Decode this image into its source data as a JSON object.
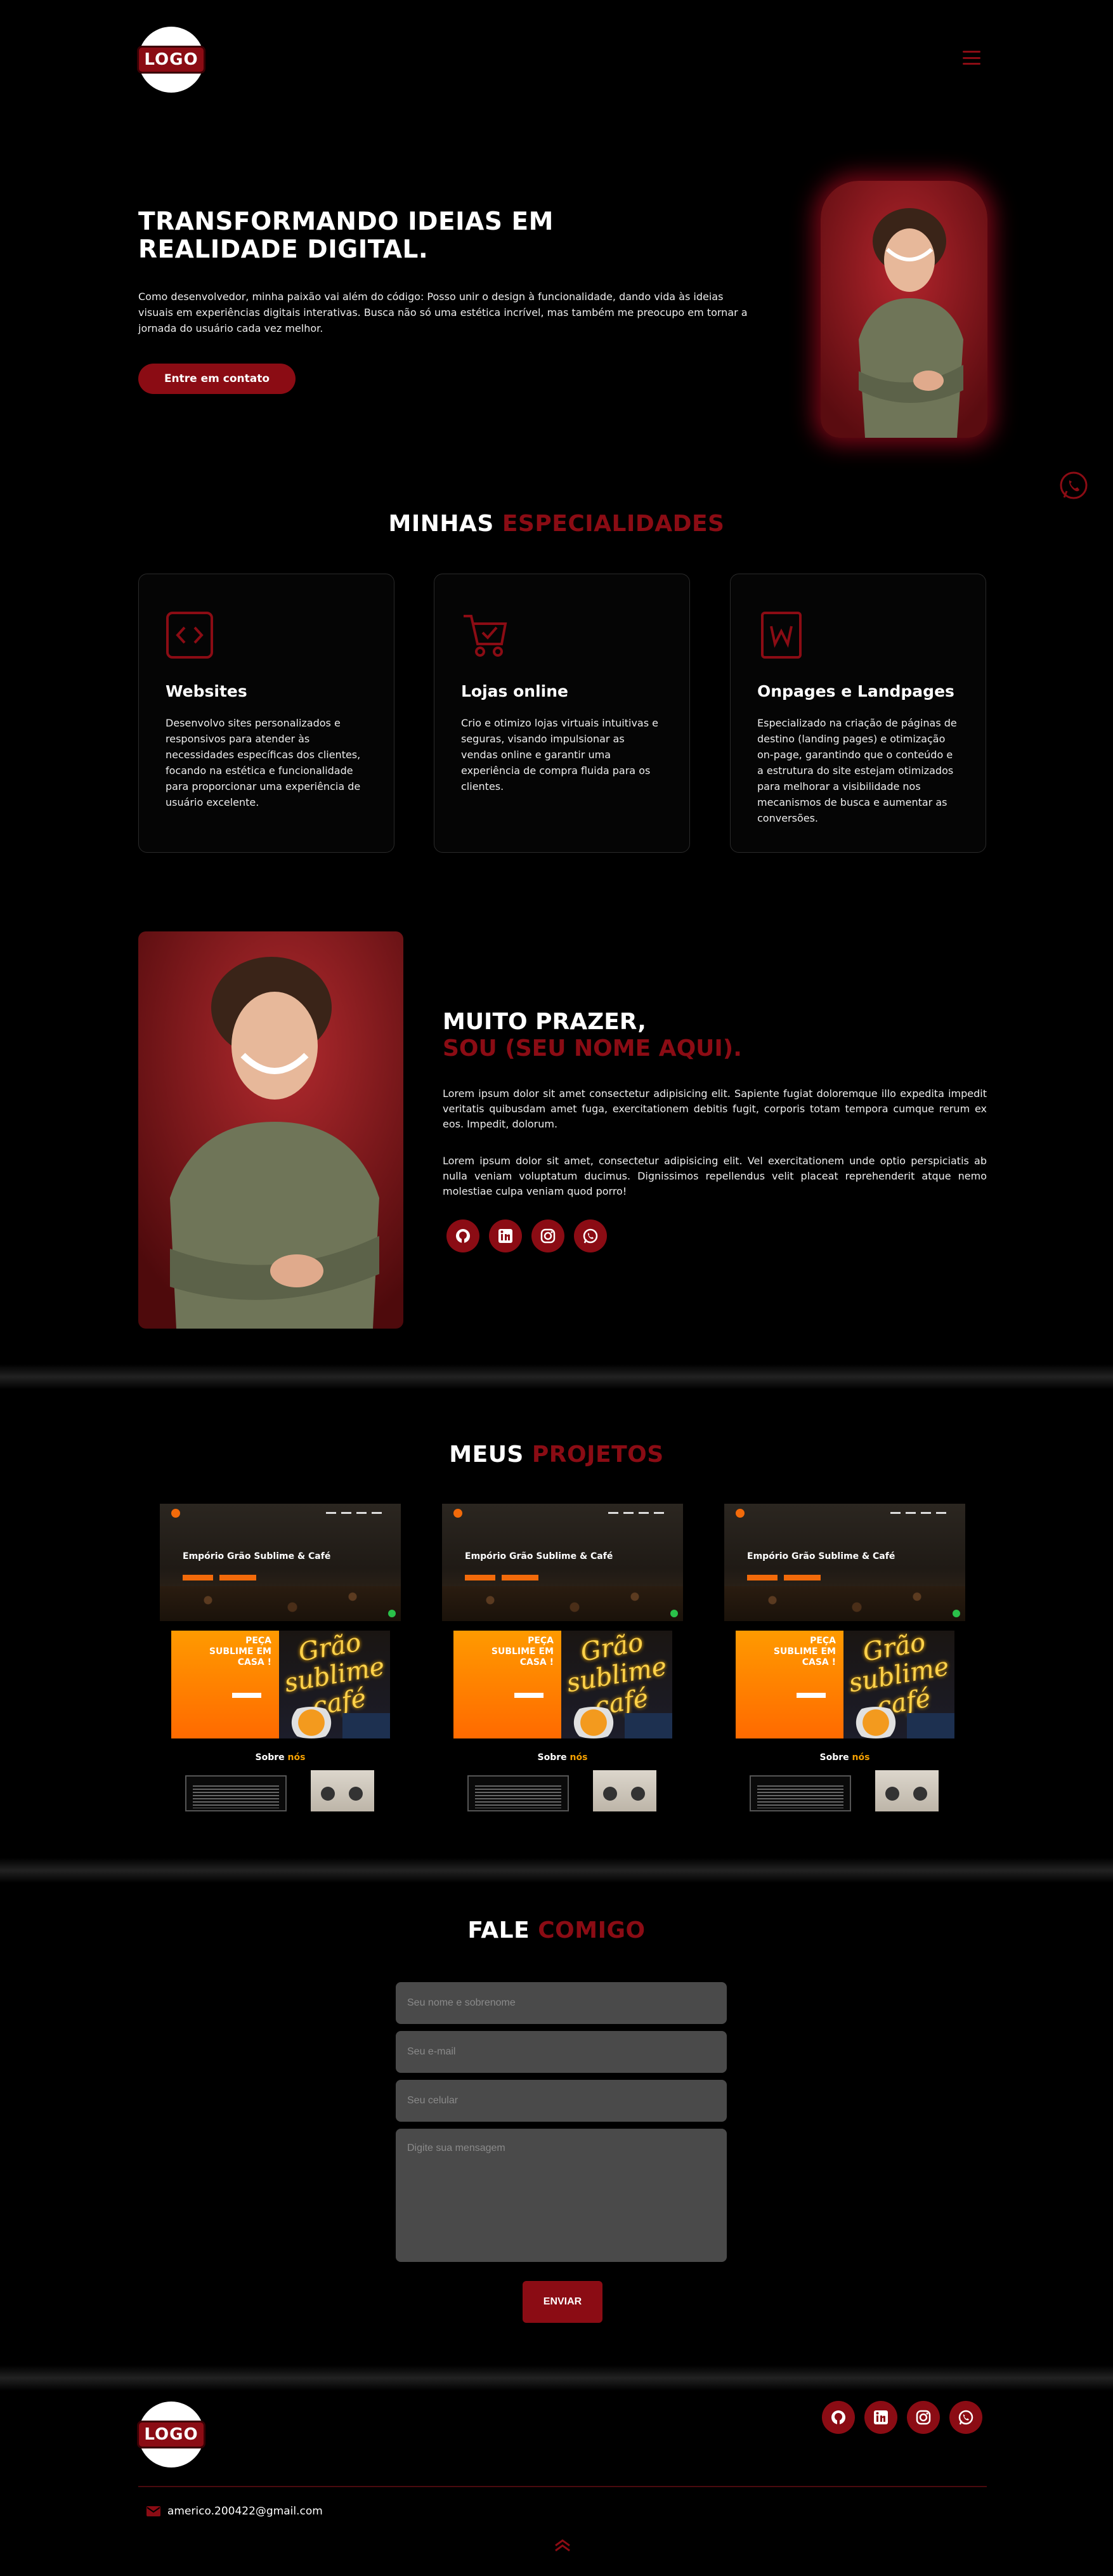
{
  "header": {
    "logo_text": "LOGO"
  },
  "hero": {
    "title": "TRANSFORMANDO IDEIAS EM REALIDADE DIGITAL.",
    "text": "Como desenvolvedor, minha paixão vai além do código: Posso unir o design à funcionalidade, dando vida às ideias visuais em experiências digitais interativas. Busca não só uma estética incrível, mas também me preocupo em tornar a jornada do usuário cada vez melhor.",
    "button": "Entre em contato"
  },
  "specialties": {
    "title_white": "MINHAS",
    "title_red": "ESPECIALIDADES",
    "cards": [
      {
        "icon": "code-icon",
        "title": "Websites",
        "text": "Desenvolvo sites personalizados e responsivos para atender às necessidades específicas dos clientes, focando na estética e funcionalidade para proporcionar uma experiência de usuário excelente."
      },
      {
        "icon": "shopping-cart-icon",
        "title": "Lojas online",
        "text": "Crio e otimizo lojas virtuais intuitivas e seguras, visando impulsionar as vendas online e garantir uma experiência de compra fluida para os clientes."
      },
      {
        "icon": "wordpress-icon",
        "title": "Onpages e Landpages",
        "text": "Especializado na criação de páginas de destino (landing pages) e otimização on-page, garantindo que o conteúdo e a estrutura do site estejam otimizados para melhorar a visibilidade nos mecanismos de busca e aumentar as conversões."
      }
    ]
  },
  "about": {
    "title_white": "MUITO PRAZER,",
    "title_red": "SOU (SEU NOME AQUI).",
    "paragraph1": "Lorem ipsum dolor sit amet consectetur adipisicing elit. Sapiente fugiat doloremque illo expedita impedit veritatis quibusdam amet fuga, exercitationem debitis fugit, corporis totam tempora cumque rerum ex eos. Impedit, dolorum.",
    "paragraph2": "Lorem ipsum dolor sit amet, consectetur adipisicing elit. Vel exercitationem unde optio perspiciatis ab nulla veniam voluptatum ducimus. Dignissimos repellendus velit placeat reprehenderit atque nemo molestiae culpa veniam quod porro!",
    "social_icons": [
      "github-icon",
      "linkedin-icon",
      "instagram-icon",
      "whatsapp-icon"
    ]
  },
  "projects": {
    "title_white": "MEUS",
    "title_red": "PROJETOS",
    "items": [
      {
        "site_title": "Empório Grão Sublime & Café",
        "promo": "PEÇA SUBLIME EM CASA !",
        "neon": "Grão sublime café",
        "sobre_white": "Sobre",
        "sobre_orange": "nós"
      },
      {
        "site_title": "Empório Grão Sublime & Café",
        "promo": "PEÇA SUBLIME EM CASA !",
        "neon": "Grão sublime café",
        "sobre_white": "Sobre",
        "sobre_orange": "nós"
      },
      {
        "site_title": "Empório Grão Sublime & Café",
        "promo": "PEÇA SUBLIME EM CASA !",
        "neon": "Grão sublime café",
        "sobre_white": "Sobre",
        "sobre_orange": "nós"
      }
    ]
  },
  "contact": {
    "title_white": "FALE",
    "title_red": "COMIGO",
    "name_placeholder": "Seu nome e sobrenome",
    "email_placeholder": "Seu e-mail",
    "phone_placeholder": "Seu celular",
    "message_placeholder": "Digite sua mensagem",
    "send": "ENVIAR"
  },
  "footer": {
    "logo_text": "LOGO",
    "email": "americo.200422@gmail.com"
  },
  "colors": {
    "accent": "#8b0c14",
    "background": "#000000",
    "field": "#4a4a4a"
  }
}
